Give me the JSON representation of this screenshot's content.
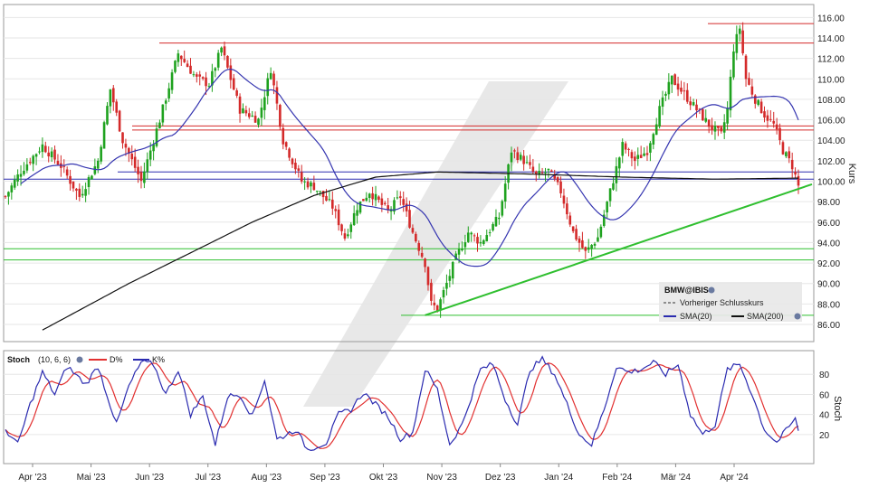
{
  "chart_data": {
    "type": "candlestick",
    "instrument": "BMW@IBIS",
    "y_axis_label": "Kurs",
    "y_ticks": [
      86,
      88,
      90,
      92,
      94,
      96,
      98,
      100,
      102,
      104,
      106,
      108,
      110,
      112,
      114,
      116
    ],
    "y_tick_labels": [
      "86.00",
      "88.00",
      "90.00",
      "92.00",
      "94.00",
      "96.00",
      "98.00",
      "100.00",
      "102.00",
      "104.00",
      "106.00",
      "108.00",
      "110.00",
      "112.00",
      "114.00",
      "116.00"
    ],
    "x_labels": [
      "Apr '23",
      "Mai '23",
      "Jun '23",
      "Jul '23",
      "Aug '23",
      "Sep '23",
      "Okt '23",
      "Nov '23",
      "Dez '23",
      "Jan '24",
      "Feb '24",
      "Mär '24",
      "Apr '24"
    ],
    "ylim": [
      84.5,
      117
    ],
    "legend": {
      "prev_close": "Vorheriger Schlusskurs",
      "sma20": "SMA(20)",
      "sma200": "SMA(200)"
    },
    "price_anchors": [
      [
        0,
        98.5
      ],
      [
        5,
        101
      ],
      [
        12,
        103.5
      ],
      [
        18,
        101.5
      ],
      [
        24,
        98.5
      ],
      [
        30,
        102
      ],
      [
        34,
        109
      ],
      [
        38,
        104
      ],
      [
        44,
        100
      ],
      [
        50,
        106
      ],
      [
        56,
        112.5
      ],
      [
        62,
        110
      ],
      [
        66,
        109.5
      ],
      [
        70,
        113
      ],
      [
        76,
        107
      ],
      [
        82,
        106
      ],
      [
        86,
        111
      ],
      [
        90,
        104
      ],
      [
        96,
        100
      ],
      [
        100,
        99.5
      ],
      [
        106,
        97.5
      ],
      [
        110,
        94.5
      ],
      [
        114,
        97.5
      ],
      [
        118,
        99
      ],
      [
        124,
        97
      ],
      [
        128,
        98.5
      ],
      [
        132,
        95
      ],
      [
        136,
        92
      ],
      [
        138,
        88
      ],
      [
        140,
        87.5
      ],
      [
        143,
        90
      ],
      [
        146,
        92.5
      ],
      [
        150,
        95
      ],
      [
        154,
        94
      ],
      [
        160,
        96.5
      ],
      [
        164,
        103
      ],
      [
        168,
        102
      ],
      [
        172,
        100.5
      ],
      [
        176,
        101
      ],
      [
        180,
        99
      ],
      [
        184,
        95
      ],
      [
        188,
        93
      ],
      [
        192,
        94.5
      ],
      [
        196,
        99
      ],
      [
        200,
        103.5
      ],
      [
        204,
        102
      ],
      [
        208,
        103
      ],
      [
        212,
        107
      ],
      [
        216,
        110
      ],
      [
        220,
        108.5
      ],
      [
        224,
        107
      ],
      [
        228,
        105.5
      ],
      [
        232,
        104.5
      ],
      [
        234,
        107
      ],
      [
        236,
        113
      ],
      [
        238,
        115
      ],
      [
        240,
        110
      ],
      [
        243,
        108
      ],
      [
        246,
        106.5
      ],
      [
        249,
        105.5
      ],
      [
        252,
        103
      ],
      [
        255,
        101.5
      ],
      [
        256,
        100.5
      ],
      [
        257,
        99.5
      ]
    ],
    "horizontal_levels": {
      "red": [
        115.4,
        113.5,
        105.4,
        105.0
      ],
      "blue": [
        100.9,
        100.2
      ],
      "green": [
        93.4,
        92.3,
        86.9
      ]
    },
    "trendline_green": {
      "from": [
        136,
        86.9
      ],
      "to": [
        257,
        99.7
      ]
    },
    "stoch": {
      "label": "Stoch",
      "params": "(10, 6, 6)",
      "d_label": "D%",
      "k_label": "K%",
      "y_label": "Stoch",
      "y_ticks": [
        20,
        40,
        60,
        80
      ],
      "ylim": [
        -8,
        100
      ],
      "anchors": [
        [
          0,
          25
        ],
        [
          4,
          10
        ],
        [
          8,
          50
        ],
        [
          12,
          82
        ],
        [
          16,
          60
        ],
        [
          20,
          88
        ],
        [
          26,
          70
        ],
        [
          30,
          88
        ],
        [
          36,
          30
        ],
        [
          40,
          68
        ],
        [
          44,
          92
        ],
        [
          48,
          90
        ],
        [
          52,
          60
        ],
        [
          56,
          85
        ],
        [
          60,
          40
        ],
        [
          64,
          58
        ],
        [
          68,
          10
        ],
        [
          72,
          58
        ],
        [
          76,
          60
        ],
        [
          80,
          38
        ],
        [
          84,
          75
        ],
        [
          88,
          15
        ],
        [
          94,
          25
        ],
        [
          98,
          5
        ],
        [
          104,
          12
        ],
        [
          108,
          40
        ],
        [
          112,
          45
        ],
        [
          116,
          62
        ],
        [
          120,
          50
        ],
        [
          124,
          38
        ],
        [
          128,
          16
        ],
        [
          132,
          22
        ],
        [
          136,
          85
        ],
        [
          140,
          65
        ],
        [
          144,
          10
        ],
        [
          148,
          30
        ],
        [
          154,
          85
        ],
        [
          158,
          90
        ],
        [
          162,
          55
        ],
        [
          166,
          30
        ],
        [
          170,
          85
        ],
        [
          174,
          95
        ],
        [
          178,
          80
        ],
        [
          182,
          50
        ],
        [
          186,
          20
        ],
        [
          190,
          10
        ],
        [
          194,
          45
        ],
        [
          198,
          88
        ],
        [
          202,
          82
        ],
        [
          206,
          85
        ],
        [
          210,
          92
        ],
        [
          214,
          80
        ],
        [
          218,
          90
        ],
        [
          222,
          40
        ],
        [
          226,
          20
        ],
        [
          230,
          30
        ],
        [
          234,
          85
        ],
        [
          238,
          90
        ],
        [
          242,
          60
        ],
        [
          246,
          25
        ],
        [
          250,
          12
        ],
        [
          254,
          28
        ],
        [
          256,
          35
        ],
        [
          257,
          25
        ]
      ]
    }
  }
}
